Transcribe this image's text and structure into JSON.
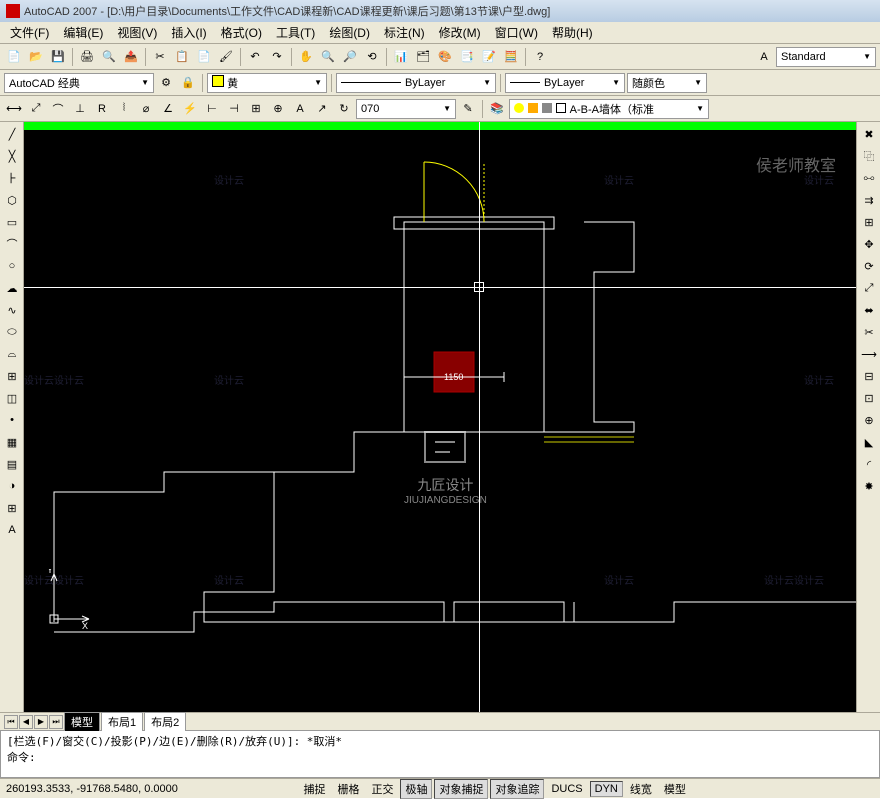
{
  "title": "AutoCAD 2007 - [D:\\用户目录\\Documents\\工作文件\\CAD课程新\\CAD课程更新\\课后习题\\第13节课\\户型.dwg]",
  "teacher_watermark": "侯老师教室",
  "menu": {
    "file": "文件(F)",
    "edit": "编辑(E)",
    "view": "视图(V)",
    "insert": "插入(I)",
    "format": "格式(O)",
    "tools": "工具(T)",
    "draw": "绘图(D)",
    "dimension": "标注(N)",
    "modify": "修改(M)",
    "window": "窗口(W)",
    "help": "帮助(H)"
  },
  "toolbar1": {
    "style_label": "Standard"
  },
  "toolbar2": {
    "workspace": "AutoCAD 经典",
    "color_name": "黄",
    "linetype": "ByLayer",
    "lineweight": "ByLayer",
    "plot_style": "随颜色"
  },
  "toolbar3": {
    "dim_value": "070",
    "layer": "A-B-A墙体（标准"
  },
  "drawing": {
    "dim_text": "1150",
    "ucs_y": "Y",
    "ucs_x": "X"
  },
  "watermarks": {
    "sjy": "设计云",
    "sjy2": "设计云设计云",
    "jjsj": "九匠设计",
    "jjd": "JIUJIANGDESIGN"
  },
  "tabs": {
    "model": "模型",
    "layout1": "布局1",
    "layout2": "布局2"
  },
  "command": {
    "history1": "[栏选(F)/窗交(C)/投影(P)/边(E)/删除(R)/放弃(U)]:   *取消*",
    "prompt": "命令:"
  },
  "status": {
    "coords": "260193.3533, -91768.5480, 0.0000",
    "snap": "捕捉",
    "grid": "栅格",
    "ortho": "正交",
    "polar": "极轴",
    "osnap": "对象捕捉",
    "otrack": "对象追踪",
    "ducs": "DUCS",
    "dyn": "DYN",
    "lwt": "线宽",
    "model": "模型"
  }
}
